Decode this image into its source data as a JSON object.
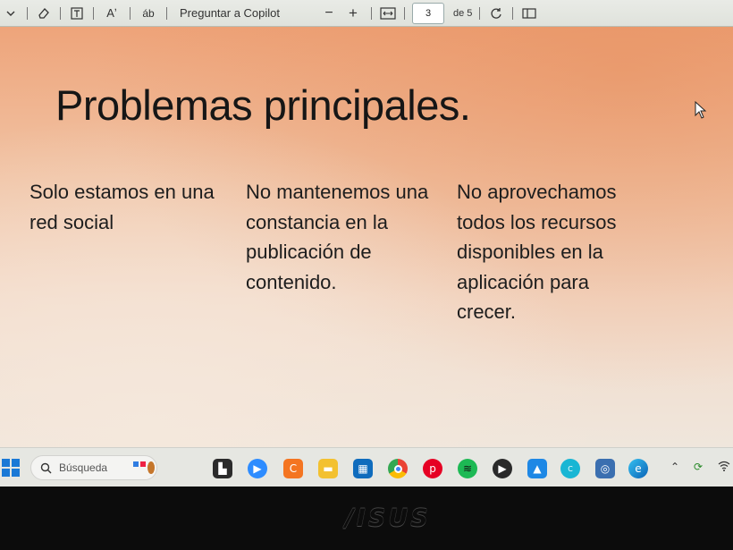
{
  "toolbar": {
    "copilot_label": "Preguntar a Copilot",
    "zoom_out": "−",
    "zoom_in": "+",
    "current_page": "3",
    "page_total": "de 5",
    "read_aloud": "Aʼ",
    "translate": "áb"
  },
  "slide": {
    "title": "Problemas principales.",
    "columns": [
      {
        "text": "Solo estamos en una red social"
      },
      {
        "text": "No mantenemos una constancia en la publicación de contenido."
      },
      {
        "text": "No aprovechamos todos los recursos disponibles en la aplicación para crecer."
      }
    ]
  },
  "taskbar": {
    "search_placeholder": "Búsqueda",
    "apps": [
      "widgets",
      "basketball-game",
      "terminal",
      "zoom",
      "crunchyroll",
      "file-explorer",
      "microsoft-store",
      "chrome",
      "pinterest",
      "spotify",
      "media-player",
      "photos",
      "canva",
      "app-settings",
      "edge"
    ]
  },
  "bezel": {
    "brand": "/ISUS"
  },
  "colors": {
    "start_blue": "#1a79d6",
    "slide_top": "#eea47a",
    "slide_bottom": "#efe6dc"
  }
}
